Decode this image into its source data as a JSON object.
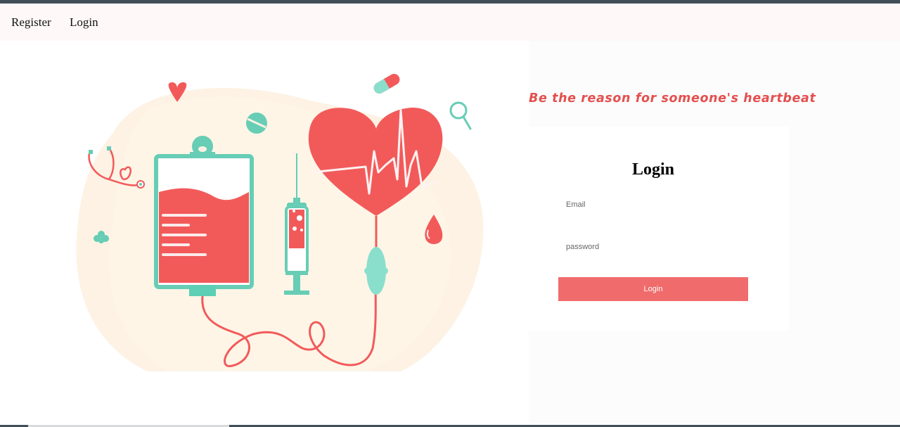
{
  "nav": {
    "register_label": "Register",
    "login_label": "Login"
  },
  "hero": {
    "tagline": "Be the reason for someone's heartbeat"
  },
  "form": {
    "title": "Login",
    "email_placeholder": "Email",
    "password_placeholder": "password",
    "submit_label": "Login"
  },
  "colors": {
    "accent": "#f06b6b",
    "tagline": "#e4504f",
    "teal": "#5ccfb5",
    "blob": "#fdf1e3"
  },
  "illustration": {
    "icon": "blood-donation-illustration"
  }
}
